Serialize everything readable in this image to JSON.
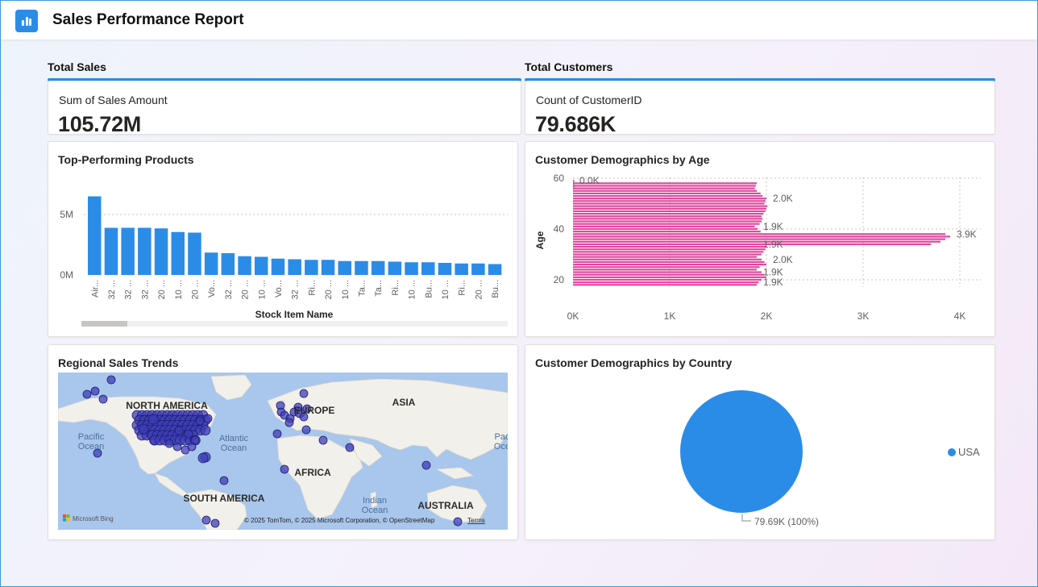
{
  "header": {
    "title": "Sales Performance Report",
    "icon": "bar-chart-icon"
  },
  "colors": {
    "accent": "#2b8ce8",
    "bar": "#2b8ce8",
    "age_bar": "#e0489c",
    "pie": "#2b8ce8",
    "map_point": "#3d3db8"
  },
  "total_sales": {
    "section_title": "Total Sales",
    "label": "Sum of Sales Amount",
    "value": "105.72M"
  },
  "total_customers": {
    "section_title": "Total Customers",
    "label": "Count of CustomerID",
    "value": "79.686K"
  },
  "top_products": {
    "title": "Top-Performing Products",
    "xlabel": "Stock Item Name",
    "chart_data": {
      "type": "bar",
      "xlabel": "Stock Item Name",
      "ylabel": "",
      "ylim": [
        0,
        8000000
      ],
      "yticks": [
        {
          "value": 0,
          "label": "0M"
        },
        {
          "value": 5000000,
          "label": "5M"
        }
      ],
      "categories": [
        "Air...",
        "32 ...",
        "32 ...",
        "32 ...",
        "20 ...",
        "10 ...",
        "20 ...",
        "Vo...",
        "32 ...",
        "20 ...",
        "10 ...",
        "Vo...",
        "32 ...",
        "Ri...",
        "20 ...",
        "10 ...",
        "Ta...",
        "Ta...",
        "Ri...",
        "10 ...",
        "Bu...",
        "10 ...",
        "Ri...",
        "20 ...",
        "Bu..."
      ],
      "values": [
        6500000,
        3900000,
        3900000,
        3900000,
        3850000,
        3550000,
        3500000,
        1850000,
        1800000,
        1550000,
        1500000,
        1350000,
        1300000,
        1250000,
        1250000,
        1150000,
        1150000,
        1150000,
        1100000,
        1050000,
        1050000,
        1000000,
        950000,
        950000,
        900000
      ]
    }
  },
  "age_demo": {
    "title": "Customer Demographics by Age",
    "chart_data": {
      "type": "bar",
      "orientation": "horizontal",
      "ylabel": "Age",
      "xlim": [
        0,
        4200
      ],
      "xticks": [
        {
          "value": 0,
          "label": "0K"
        },
        {
          "value": 1000,
          "label": "1K"
        },
        {
          "value": 2000,
          "label": "2K"
        },
        {
          "value": 3000,
          "label": "3K"
        },
        {
          "value": 4000,
          "label": "4K"
        }
      ],
      "ylim": [
        17,
        62
      ],
      "yticks": [
        {
          "value": 20,
          "label": "20"
        },
        {
          "value": 40,
          "label": "40"
        },
        {
          "value": 60,
          "label": "60"
        }
      ],
      "ages": [
        18,
        19,
        20,
        21,
        22,
        23,
        24,
        25,
        26,
        27,
        28,
        29,
        30,
        31,
        32,
        33,
        34,
        35,
        36,
        37,
        38,
        39,
        40,
        41,
        42,
        43,
        44,
        45,
        46,
        47,
        48,
        49,
        50,
        51,
        52,
        53,
        54,
        55,
        56,
        57,
        58,
        59,
        60
      ],
      "values": [
        1900,
        1920,
        1950,
        2000,
        1980,
        1950,
        1900,
        1930,
        2000,
        1980,
        1950,
        1900,
        1950,
        1970,
        1990,
        2000,
        3700,
        3800,
        3850,
        3900,
        3850,
        1940,
        1910,
        1880,
        1930,
        1950,
        1960,
        1950,
        1970,
        1990,
        2000,
        2010,
        1980,
        1990,
        2000,
        1960,
        1940,
        1900,
        1880,
        1890,
        1900,
        0,
        0
      ],
      "data_labels": [
        {
          "age": 59,
          "label": "0.0K",
          "value": 0
        },
        {
          "age": 52,
          "label": "2.0K",
          "value": 2000
        },
        {
          "age": 41,
          "label": "1.9K",
          "value": 1900
        },
        {
          "age": 38,
          "label": "3.9K",
          "value": 3900
        },
        {
          "age": 34,
          "label": "1.9K",
          "value": 1900
        },
        {
          "age": 28,
          "label": "2.0K",
          "value": 2000
        },
        {
          "age": 23,
          "label": "1.9K",
          "value": 1900
        },
        {
          "age": 19,
          "label": "1.9K",
          "value": 1900
        }
      ]
    }
  },
  "regional": {
    "title": "Regional Sales Trends",
    "labels": {
      "north_america": "NORTH AMERICA",
      "europe": "EUROPE",
      "asia": "ASIA",
      "africa": "AFRICA",
      "south_america": "SOUTH AMERICA",
      "australia": "AUSTRALIA",
      "pacific_1": "Pacific",
      "pacific_2": "Ocean",
      "atlantic_1": "Atlantic",
      "atlantic_2": "Ocean",
      "indian_1": "Indian",
      "indian_2": "Ocean",
      "pac_right_1": "Pac",
      "pac_right_2": "Oce"
    },
    "bing": "Microsoft Bing",
    "copyright": "© 2025 TomTom, © 2025 Microsoft Corporation, © OpenStreetMap",
    "terms": "Terms"
  },
  "country_demo": {
    "title": "Customer Demographics by Country",
    "chart_data": {
      "type": "pie",
      "slices": [
        {
          "label": "USA",
          "value": 79686,
          "percent": 100
        }
      ],
      "data_label": "79.69K (100%)",
      "legend": {
        "position": "right",
        "items": [
          "USA"
        ]
      }
    }
  }
}
